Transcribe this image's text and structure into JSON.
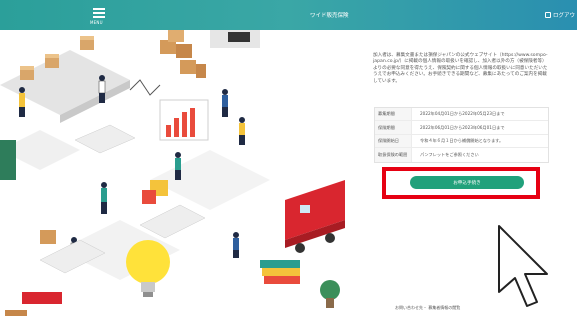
{
  "header": {
    "menu_label": "MENU",
    "site_title": "ワイド販売保険",
    "logout_label": "ログアウ"
  },
  "intro_text": "加入者は、募集文書または損保ジャパンの公式ウェブサイト（https://www.sompo-japan.co.jp/）に掲載の個人情報の取扱いを確認し、加入者以外の方（被保険者等）よりの必要な同意を得たうえ、保険契約に関する個人情報の取扱いに同意いただいたうえでお申込みください。お手続きできる期間など、募集にあたってのご案内を掲載しています。",
  "info_table": [
    {
      "key": "募集期間",
      "value": "2022年04月01日から2022年05月23日まで"
    },
    {
      "key": "保険期間",
      "value": "2022年06月01日から2023年06月01日まで"
    },
    {
      "key": "保険開始日",
      "value": "令和４年６月１日から補償開始となります。"
    },
    {
      "key": "取扱保険の範囲",
      "value": "パンフレットをご参照ください"
    }
  ],
  "apply_button_label": "お申込手続き",
  "footer_text": "お問い合わせ先・ 募集者情報の閲覧",
  "colors": {
    "header_start": "#2b9f9a",
    "header_end": "#2a8fb0",
    "apply_button": "#21a17b",
    "highlight_box": "#e60012"
  }
}
